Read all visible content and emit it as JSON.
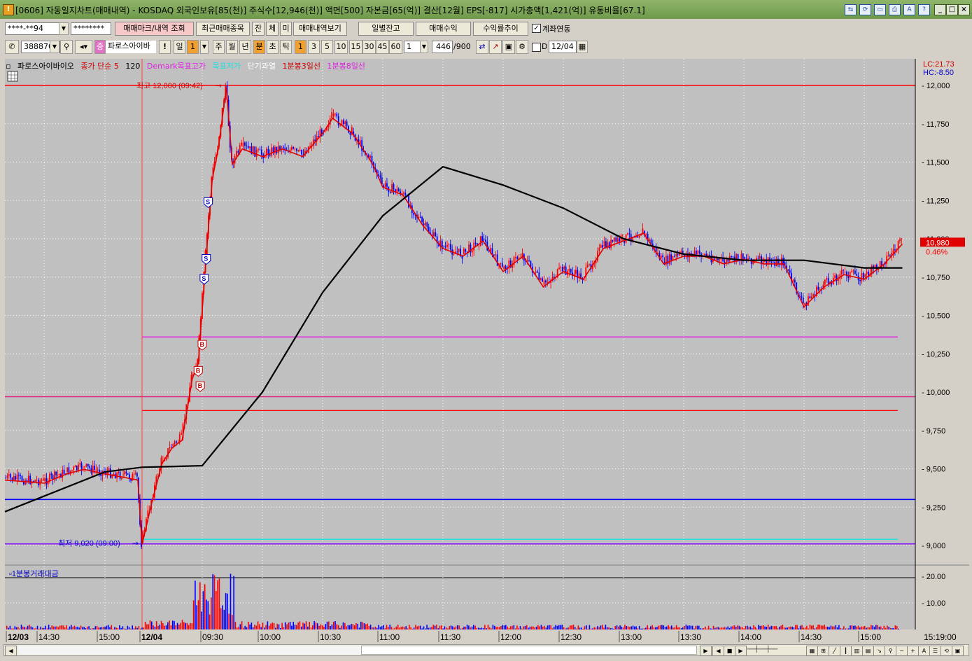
{
  "title": "[0606] 자동일지차트(매매내역) - KOSDAQ 외국인보유[85(천)] 주식수[12,946(천)] 액면[500] 자본금[65(억)] 결산[12월] EPS[-817] 시가총액[1,421(억)] 유통비율[67.1]",
  "toolbar1": {
    "account": "****-**94",
    "password": "********",
    "buttons": [
      "매매마크/내역 조회",
      "최근매매종목",
      "잔",
      "체",
      "미",
      "매매내역보기"
    ],
    "right_buttons": [
      "일별잔고",
      "매매수익",
      "수익률추이"
    ],
    "checkbox_label": "계좌연동"
  },
  "toolbar2": {
    "code": "388870",
    "stock_name": "파로스아이바",
    "periods": [
      "일",
      "1",
      "주",
      "월",
      "년",
      "분",
      "초",
      "틱"
    ],
    "intervals": [
      "1",
      "3",
      "5",
      "10",
      "15",
      "30",
      "45",
      "60"
    ],
    "interval_value": "1",
    "count": "446",
    "count_total": "/900",
    "d_label": "D",
    "date": "12/04"
  },
  "legend": [
    {
      "text": "파로스아이바이오",
      "color": "#000000"
    },
    {
      "text": "종가 단순 5",
      "color": "#d00000"
    },
    {
      "text": "120",
      "color": "#000000"
    },
    {
      "text": "Demark목표고가",
      "color": "#e020e0"
    },
    {
      "text": "목표저가",
      "color": "#20e0e0"
    },
    {
      "text": "단기과열",
      "color": "#ffffff"
    },
    {
      "text": "1분봉3일선",
      "color": "#d00000"
    },
    {
      "text": "1분봉8일선",
      "color": "#e020e0"
    }
  ],
  "lc_label": "LC:21.73",
  "hc_label": "HC:-8.50",
  "current_price": "10,980",
  "current_change": "0.46%",
  "high_label": "최고 12,000 (09:42)",
  "low_label": "최저 9,020 (09:00)",
  "volume_title": "1분봉거래대금",
  "price_axis": [
    "12,000",
    "11,750",
    "11,500",
    "11,250",
    "11,000",
    "10,750",
    "10,500",
    "10,250",
    "10,000",
    "9,750",
    "9,500",
    "9,250",
    "9,000"
  ],
  "volume_axis": [
    "20.00",
    "10.00"
  ],
  "time_axis": [
    "12/03",
    "14:30",
    "15:00",
    "12/04",
    "09:30",
    "10:00",
    "10:30",
    "11:00",
    "11:30",
    "12:00",
    "12:30",
    "13:00",
    "13:30",
    "14:00",
    "14:30",
    "15:00"
  ],
  "time_now": "15:19:00",
  "colors": {
    "up": "#ff0000",
    "down": "#0000ff",
    "ma120": "#000000",
    "bg": "#c0c0c0"
  },
  "chart_data": {
    "type": "line",
    "series": [
      {
        "name": "파로스아이바이오",
        "points": [
          [
            "12/03 14:20",
            9440
          ],
          [
            "12/03 14:30",
            9420
          ],
          [
            "12/03 14:40",
            9480
          ],
          [
            "12/03 14:50",
            9510
          ],
          [
            "12/03 15:00",
            9480
          ],
          [
            "12/03 15:10",
            9460
          ],
          [
            "12/03 15:20",
            9440
          ],
          [
            "09:00",
            9020
          ],
          [
            "09:05",
            9300
          ],
          [
            "09:10",
            9550
          ],
          [
            "09:15",
            9650
          ],
          [
            "09:20",
            9700
          ],
          [
            "09:25",
            10100
          ],
          [
            "09:28",
            10200
          ],
          [
            "09:32",
            10900
          ],
          [
            "09:35",
            11400
          ],
          [
            "09:38",
            11600
          ],
          [
            "09:42",
            12000
          ],
          [
            "09:45",
            11500
          ],
          [
            "09:50",
            11600
          ],
          [
            "10:00",
            11550
          ],
          [
            "10:10",
            11600
          ],
          [
            "10:20",
            11550
          ],
          [
            "10:30",
            11700
          ],
          [
            "10:35",
            11800
          ],
          [
            "10:45",
            11700
          ],
          [
            "10:55",
            11500
          ],
          [
            "11:00",
            11350
          ],
          [
            "11:10",
            11300
          ],
          [
            "11:20",
            11100
          ],
          [
            "11:30",
            10950
          ],
          [
            "11:40",
            10900
          ],
          [
            "11:50",
            11000
          ],
          [
            "12:00",
            10800
          ],
          [
            "12:10",
            10900
          ],
          [
            "12:20",
            10700
          ],
          [
            "12:30",
            10800
          ],
          [
            "12:40",
            10750
          ],
          [
            "12:50",
            10950
          ],
          [
            "13:00",
            11000
          ],
          [
            "13:10",
            11050
          ],
          [
            "13:20",
            10850
          ],
          [
            "13:30",
            10900
          ],
          [
            "13:40",
            10900
          ],
          [
            "13:50",
            10850
          ],
          [
            "14:00",
            10880
          ],
          [
            "14:10",
            10850
          ],
          [
            "14:20",
            10850
          ],
          [
            "14:30",
            10570
          ],
          [
            "14:40",
            10700
          ],
          [
            "14:50",
            10780
          ],
          [
            "15:00",
            10750
          ],
          [
            "15:10",
            10850
          ],
          [
            "15:19",
            10980
          ]
        ]
      },
      {
        "name": "120",
        "points": [
          [
            "12/03 14:20",
            9220
          ],
          [
            "12/03 15:00",
            9480
          ],
          [
            "09:00",
            9510
          ],
          [
            "09:30",
            9520
          ],
          [
            "10:00",
            10000
          ],
          [
            "10:30",
            10650
          ],
          [
            "11:00",
            11150
          ],
          [
            "11:30",
            11470
          ],
          [
            "12:00",
            11350
          ],
          [
            "12:30",
            11200
          ],
          [
            "13:00",
            11000
          ],
          [
            "13:30",
            10900
          ],
          [
            "14:00",
            10860
          ],
          [
            "14:30",
            10860
          ],
          [
            "15:00",
            10810
          ],
          [
            "15:19",
            10810
          ]
        ]
      }
    ],
    "horizontal_lines": [
      {
        "value": 12000,
        "color": "#ff0000"
      },
      {
        "value": 10360,
        "color": "#e020e0"
      },
      {
        "value": 9970,
        "color": "#e02080"
      },
      {
        "value": 9880,
        "color": "#ff0000"
      },
      {
        "value": 9300,
        "color": "#0000ff"
      },
      {
        "value": 9040,
        "color": "#20e0e0"
      },
      {
        "value": 9010,
        "color": "#8000ff"
      }
    ],
    "markers": [
      {
        "type": "S",
        "time": "09:33",
        "price": 11240
      },
      {
        "type": "S",
        "time": "09:32",
        "price": 10870
      },
      {
        "type": "S",
        "time": "09:31",
        "price": 10740
      },
      {
        "type": "B",
        "time": "09:30",
        "price": 10310
      },
      {
        "type": "B",
        "time": "09:28",
        "price": 10140
      },
      {
        "type": "B",
        "time": "09:29",
        "price": 10040
      }
    ],
    "ylim": [
      8950,
      12050
    ]
  }
}
